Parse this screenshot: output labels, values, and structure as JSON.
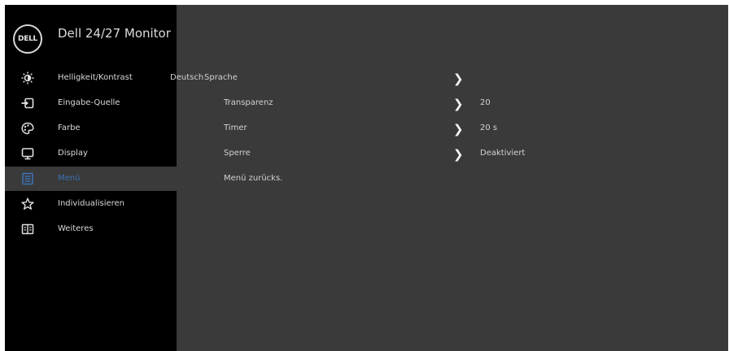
{
  "app": {
    "logo_text": "DELL",
    "title": "Dell 24/27 Monitor"
  },
  "sidebar": {
    "items": [
      {
        "label": "Helligkeit/Kontrast",
        "icon": "brightness-icon"
      },
      {
        "label": "Eingabe-Quelle",
        "icon": "input-source-icon"
      },
      {
        "label": "Farbe",
        "icon": "color-palette-icon"
      },
      {
        "label": "Display",
        "icon": "display-icon"
      },
      {
        "label": "Menü",
        "icon": "menu-icon",
        "selected": true
      },
      {
        "label": "Individualisieren",
        "icon": "star-icon"
      },
      {
        "label": "Weiteres",
        "icon": "others-icon"
      }
    ]
  },
  "submenu": {
    "rows": [
      {
        "label": "Sprache",
        "prefix": "Deutsch",
        "value": ""
      },
      {
        "label": "Transparenz",
        "value": "20"
      },
      {
        "label": "Timer",
        "value": "20 s"
      },
      {
        "label": "Sperre",
        "value": "Deaktiviert"
      },
      {
        "label": "Menü zurücks.",
        "value": ""
      }
    ]
  },
  "colors": {
    "accent": "#3c73b8",
    "panel": "#3a3a3a",
    "sidebar": "#000000"
  }
}
